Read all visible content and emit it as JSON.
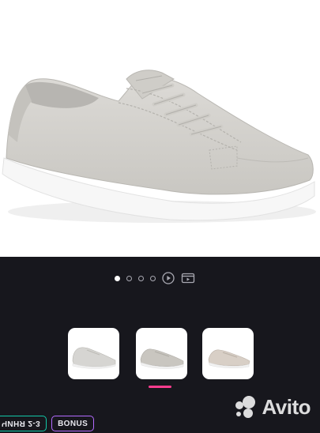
{
  "product": {
    "image_description_icon": "sneaker-photo",
    "upper_color": "#d2d0cc",
    "sole_color": "#ffffff"
  },
  "gallery": {
    "slides_count": 4,
    "active_index": 0,
    "media_icons": [
      "play-icon",
      "video-reel-icon"
    ],
    "thumbnails": [
      {
        "icon": "sneaker-thumb-1",
        "color": "#d6d5d2"
      },
      {
        "icon": "sneaker-thumb-2",
        "color": "#c9c6c0"
      },
      {
        "icon": "sneaker-thumb-3",
        "color": "#d8cfc6"
      }
    ],
    "active_thumbnail": 1,
    "indicator_color": "#ff3d8f"
  },
  "badges": {
    "rating_label": "ЧИНЯ 2-3",
    "bonus_label": "BONUS",
    "rating_color": "#12c9a8",
    "bonus_color": "#b36bff"
  },
  "watermark": {
    "text": "Avito",
    "icon": "avito-logo-icon"
  }
}
